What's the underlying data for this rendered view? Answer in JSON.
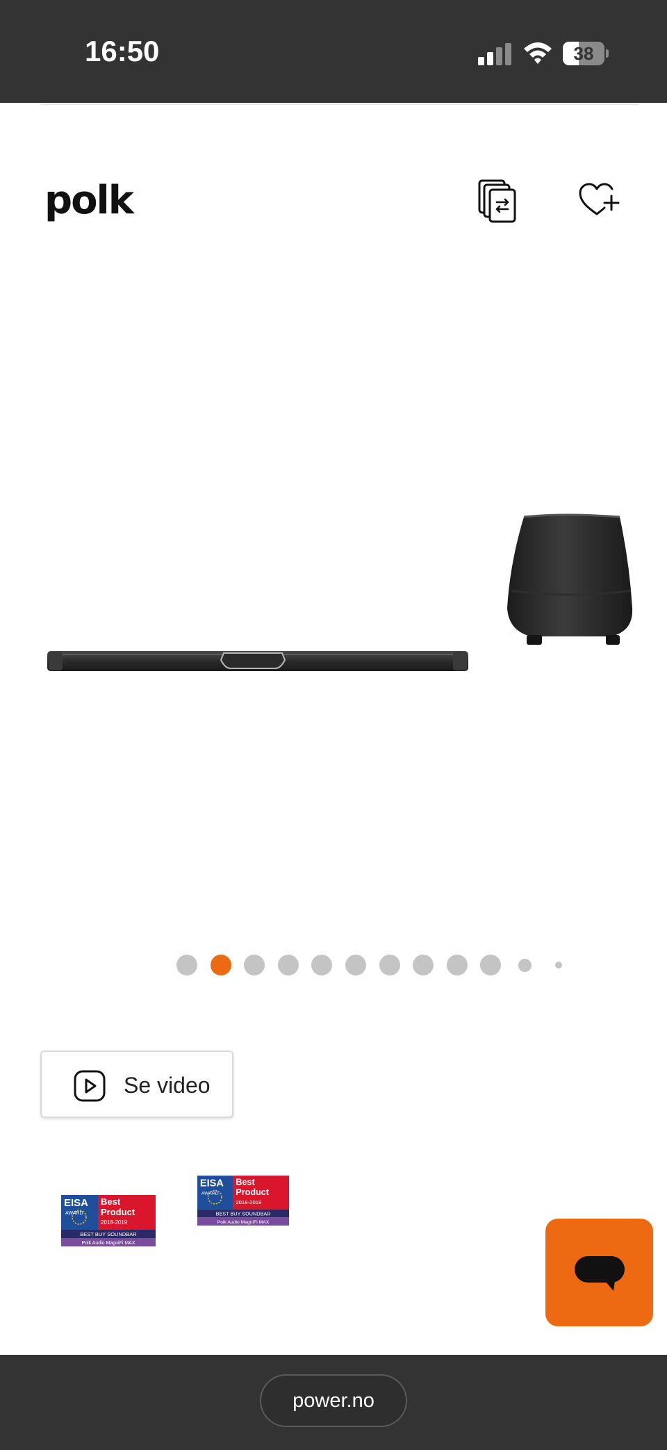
{
  "status_bar": {
    "time": "16:50",
    "battery_level": "38",
    "battery_fraction": 0.38,
    "signal_icon": "cellular-signal-icon",
    "wifi_icon": "wifi-icon",
    "battery_icon": "battery-icon"
  },
  "header": {
    "brand": "polk",
    "compare_icon": "compare-icon",
    "wishlist_icon": "heart-plus-icon"
  },
  "gallery": {
    "total_slides": 12,
    "active_index": 1
  },
  "video_button": {
    "label": "Se video",
    "icon": "play-icon"
  },
  "awards": [
    {
      "org": "EISA",
      "award_word": "AWARD",
      "title_line1": "Best",
      "title_line2": "Product",
      "years": "2018-2019",
      "category": "BEST BUY SOUNDBAR",
      "product": "Polk Audio MagniFi MAX"
    },
    {
      "org": "EISA",
      "award_word": "AWARD",
      "title_line1": "Best",
      "title_line2": "Product",
      "years": "2018-2019",
      "category": "BEST BUY SOUNDBAR",
      "product": "Polk Audio MagniFi MAX"
    }
  ],
  "chat": {
    "icon": "chat-bubble-icon"
  },
  "browser": {
    "url": "power.no"
  },
  "colors": {
    "accent": "#ee6a12",
    "status_bar": "#333333",
    "inactive_dot": "#c4c4c4",
    "award_blue": "#1f4e9c",
    "award_red": "#d9162b",
    "award_purple": "#7a4c9e",
    "award_navy": "#2a2a66"
  }
}
